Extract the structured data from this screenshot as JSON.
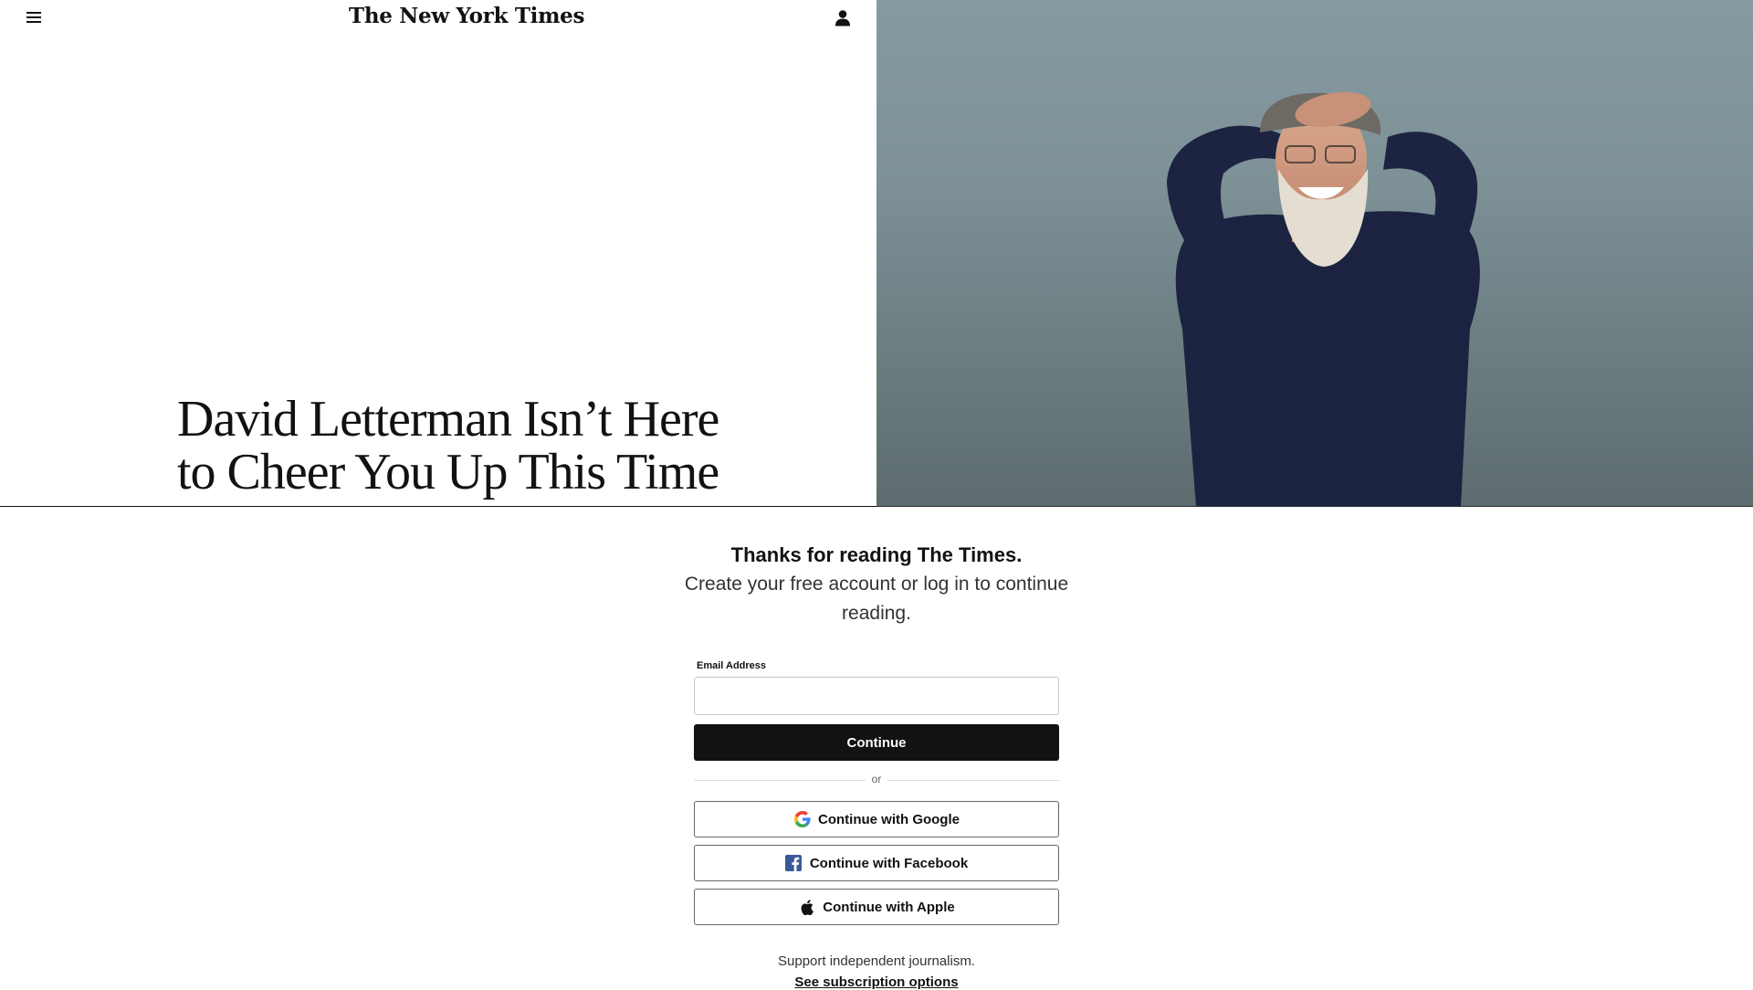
{
  "header": {
    "logo_text": "The New York Times",
    "menu_icon": "hamburger-menu-icon",
    "account_icon": "person-icon"
  },
  "article": {
    "headline_line1": "David Letterman Isn’t Here",
    "headline_line2": "to Cheer You Up This Time"
  },
  "regi": {
    "title": "Thanks for reading The Times.",
    "subtitle": "Create your free account or log in to continue reading.",
    "email_label": "Email Address",
    "email_value": "",
    "continue_label": "Continue",
    "or_text": "or",
    "google_label": "Continue with Google",
    "facebook_label": "Continue with Facebook",
    "apple_label": "Continue with Apple",
    "support_text": "Support independent journalism.",
    "subscription_link": "See subscription options"
  },
  "colors": {
    "brand_black": "#121212",
    "facebook_blue": "#3b5998",
    "sky": "#869ba1"
  }
}
